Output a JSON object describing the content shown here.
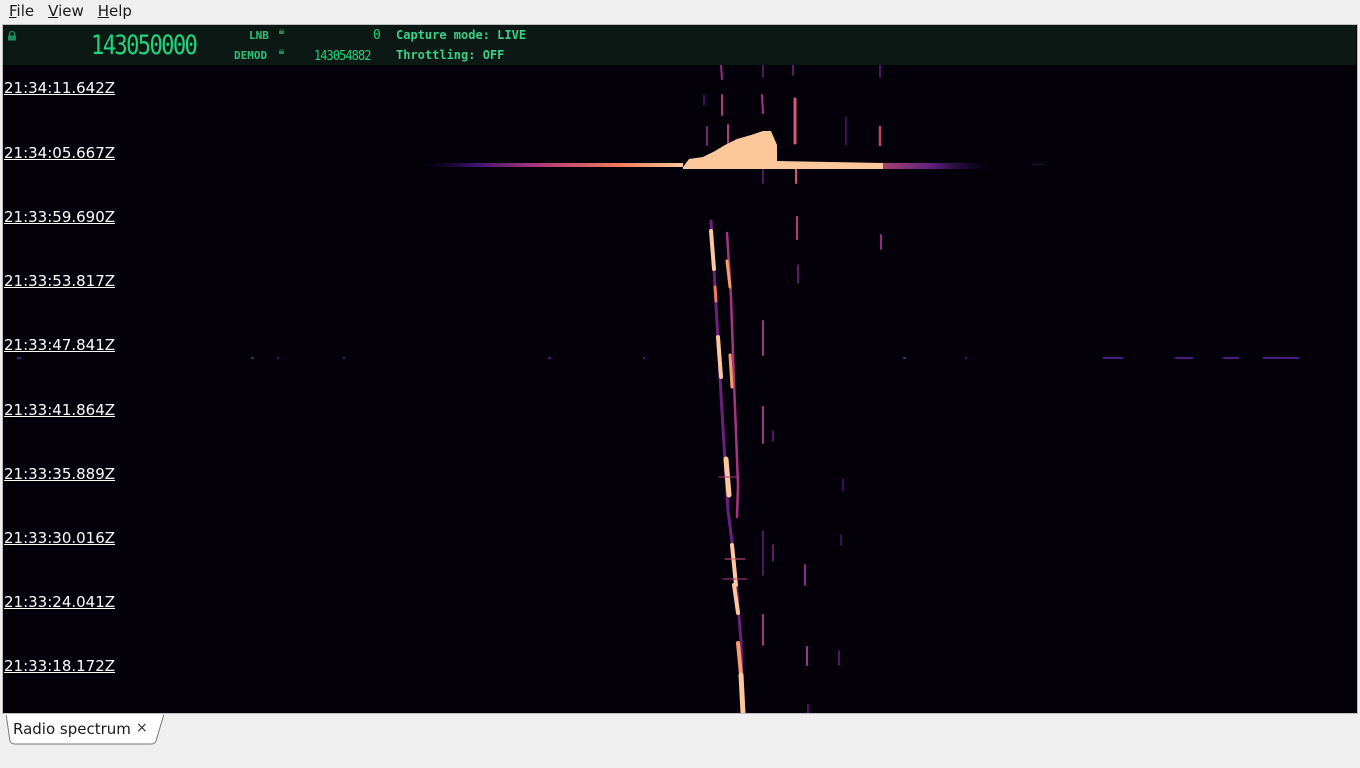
{
  "menubar": {
    "items": [
      {
        "mnemonic": "F",
        "rest": "ile"
      },
      {
        "mnemonic": "V",
        "rest": "iew"
      },
      {
        "mnemonic": "H",
        "rest": "elp"
      }
    ]
  },
  "status": {
    "main_frequency": "143050000",
    "lnb_label": "LNB",
    "lnb_value": "0",
    "demod_label": "DEMOD",
    "demod_value": "143054882",
    "capture_mode": "Capture mode: LIVE",
    "throttling": "Throttling: OFF",
    "text_color": "#22c27a",
    "background": "#0c1813",
    "lock_icon": "lock-icon"
  },
  "waterfall": {
    "colormap": "magma",
    "timestamps": [
      "21:34:11.642Z",
      "21:34:05.667Z",
      "21:33:59.690Z",
      "21:33:53.817Z",
      "21:33:47.841Z",
      "21:33:41.864Z",
      "21:33:35.889Z",
      "21:33:30.016Z",
      "21:33:24.041Z",
      "21:33:18.172Z"
    ]
  },
  "tabs": [
    {
      "label": "Radio spectrum",
      "close_icon": "close-icon",
      "close_glyph": "×"
    }
  ]
}
